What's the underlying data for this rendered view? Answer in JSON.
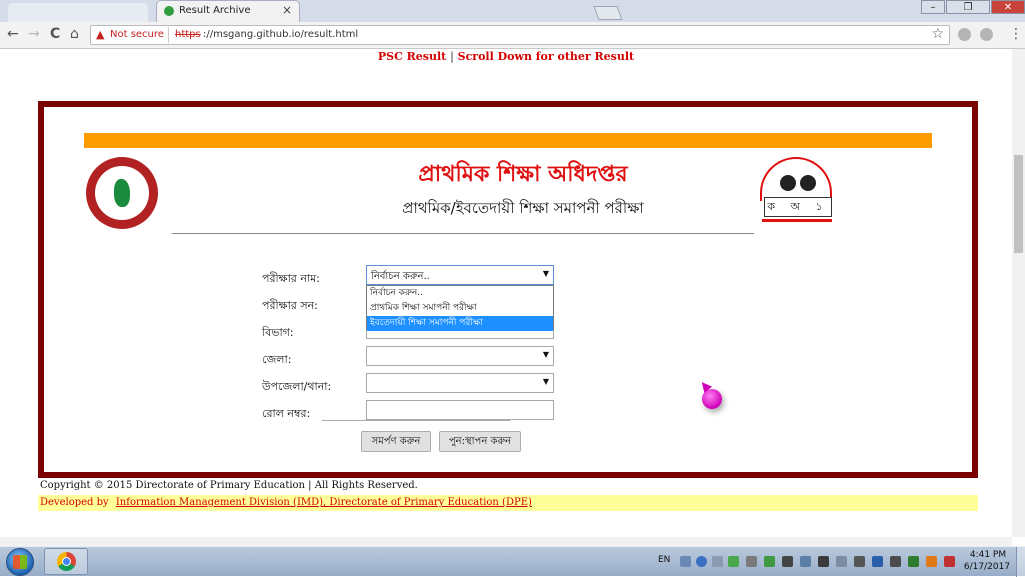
{
  "browser": {
    "tab_title": "Result Archive",
    "tab_close": "×",
    "back_icon": "←",
    "forward_icon": "→",
    "reload_icon": "C",
    "home_icon": "⌂",
    "security_icon": "▲",
    "security_label": "Not secure",
    "url_scheme": "https",
    "url_rest": "://msgang.github.io/result.html",
    "star_icon": "☆",
    "menu_icon": "⋮",
    "window_controls": {
      "minimize": "–",
      "maximize": "❐",
      "close": "✕"
    }
  },
  "page": {
    "notice_left": "PSC Result",
    "notice_sep": "|",
    "notice_right": "Scroll Down for other Result",
    "title_main": "প্রাথমিক শিক্ষা অধিদপ্তর",
    "title_sub": "প্রাথমিক/ইবতেদায়ী শিক্ষা সমাপনী পরীক্ষা",
    "right_logo_text": "ক অ ১",
    "form": {
      "exam_label": "পরীক্ষার নাম:",
      "year_label": "পরীক্ষার সন:",
      "division_label": "বিভাগ:",
      "district_label": "জেলা:",
      "upazila_label": "উপজেলা/থানা:",
      "roll_label": "রোল নম্বর:",
      "exam_value": "নির্বাচন করুন..",
      "exam_options": [
        "নির্বাচন করুন..",
        "প্রাথমিক শিক্ষা সমাপনী পরীক্ষা",
        "ইবতেদায়ী শিক্ষা সমাপনী পরীক্ষা"
      ],
      "exam_highlighted_index": 2,
      "district_value": "",
      "upazila_value": "",
      "roll_value": "",
      "submit_label": "সমর্পণ করুন",
      "reset_label": "পুন:স্থাপন করুন",
      "select_arrow": "▼"
    },
    "copyright": "Copyright © 2015 Directorate of Primary Education | All Rights Reserved.",
    "dev_prefix": "Developed by",
    "dev_link": "Information Management Division (IMD), Directorate of Primary Education (DPE)"
  },
  "taskbar": {
    "language": "EN",
    "time": "4:41 PM",
    "date": "6/17/2017"
  },
  "colors": {
    "frame": "#7b0000",
    "accent_bar": "#ff9c00",
    "title_red": "#e01010",
    "highlight": "#1e90ff",
    "dev_bar": "#ffff99"
  },
  "icons": [
    "back-icon",
    "forward-icon",
    "reload-icon",
    "home-icon",
    "warning-icon",
    "star-icon",
    "menu-icon",
    "chrome-icon",
    "windows-start-icon"
  ]
}
